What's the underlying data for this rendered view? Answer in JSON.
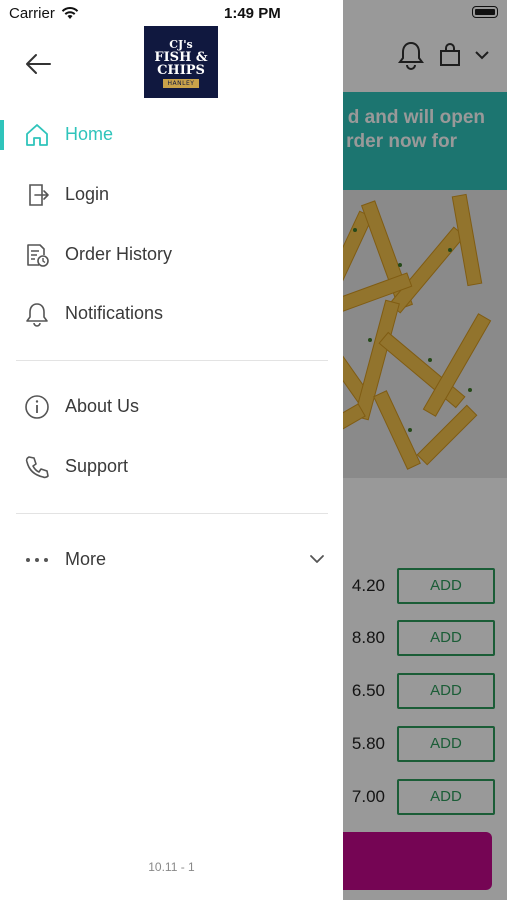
{
  "status_bar": {
    "carrier": "Carrier",
    "time": "1:49 PM"
  },
  "drawer": {
    "logo_text": [
      "CJ's",
      "FISH &",
      "CHIPS",
      "HANLEY"
    ],
    "menu_primary": [
      {
        "label": "Home",
        "icon": "home-icon",
        "active": true
      },
      {
        "label": "Login",
        "icon": "login-icon",
        "active": false
      },
      {
        "label": "Order History",
        "icon": "order-history-icon",
        "active": false
      },
      {
        "label": "Notifications",
        "icon": "bell-icon",
        "active": false
      }
    ],
    "menu_secondary": [
      {
        "label": "About Us",
        "icon": "info-icon"
      },
      {
        "label": "Support",
        "icon": "phone-icon"
      }
    ],
    "more": {
      "label": "More",
      "icon": "more-dots-icon"
    },
    "version": "10.11 - 1"
  },
  "background": {
    "banner_lines": [
      "d and will open",
      "rder now for"
    ],
    "prices": [
      "4.20",
      "8.80",
      "6.50",
      "5.80",
      "7.00"
    ],
    "add_label": "ADD"
  },
  "colors": {
    "accent": "#2fc4bb",
    "add_green": "#2e9c5c",
    "cta": "#c4098c",
    "logo_bg": "#10183f"
  }
}
